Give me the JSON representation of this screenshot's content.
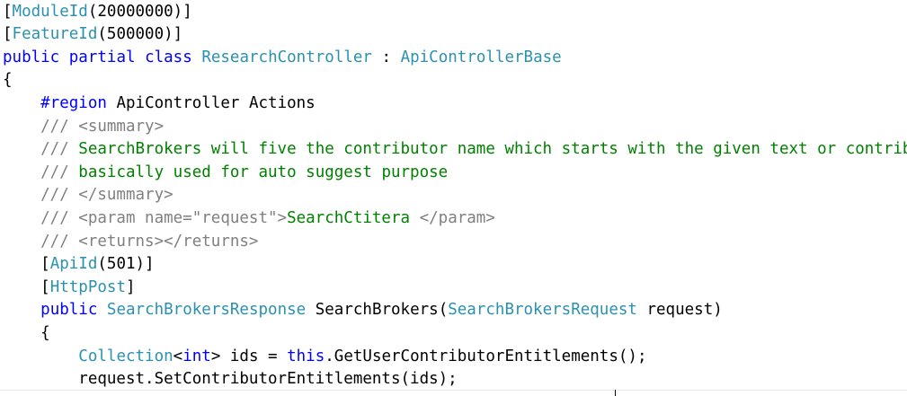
{
  "editor": {
    "language": "C#",
    "colors": {
      "background": "#ffffff",
      "plain": "#000000",
      "keyword": "#0000ff",
      "type": "#2b91af",
      "comment": "#008000",
      "xmldoc": "#808080",
      "directive": "#0000ff"
    },
    "lines": [
      {
        "tokens": [
          {
            "text": "[",
            "kind": "plain"
          },
          {
            "text": "ModuleId",
            "kind": "type"
          },
          {
            "text": "(20000000)]",
            "kind": "plain"
          }
        ]
      },
      {
        "tokens": [
          {
            "text": "[",
            "kind": "plain"
          },
          {
            "text": "FeatureId",
            "kind": "type"
          },
          {
            "text": "(500000)]",
            "kind": "plain"
          }
        ]
      },
      {
        "tokens": [
          {
            "text": "public",
            "kind": "keyword"
          },
          {
            "text": " ",
            "kind": "plain"
          },
          {
            "text": "partial",
            "kind": "keyword"
          },
          {
            "text": " ",
            "kind": "plain"
          },
          {
            "text": "class",
            "kind": "keyword"
          },
          {
            "text": " ",
            "kind": "plain"
          },
          {
            "text": "ResearchController",
            "kind": "type"
          },
          {
            "text": " : ",
            "kind": "plain"
          },
          {
            "text": "ApiControllerBase",
            "kind": "type"
          }
        ]
      },
      {
        "tokens": [
          {
            "text": "{",
            "kind": "plain"
          }
        ]
      },
      {
        "tokens": [
          {
            "text": "    ",
            "kind": "plain"
          },
          {
            "text": "#region",
            "kind": "directive"
          },
          {
            "text": " ApiController Actions",
            "kind": "plain"
          }
        ]
      },
      {
        "tokens": [
          {
            "text": "    /// <summary>",
            "kind": "xmldoc"
          }
        ]
      },
      {
        "tokens": [
          {
            "text": "    /// ",
            "kind": "xmldoc"
          },
          {
            "text": "SearchBrokers will five the contributor name which starts with the given text or contributor type",
            "kind": "comment"
          }
        ]
      },
      {
        "tokens": [
          {
            "text": "    /// ",
            "kind": "xmldoc"
          },
          {
            "text": "basically used for auto suggest purpose",
            "kind": "comment"
          }
        ]
      },
      {
        "tokens": [
          {
            "text": "    /// </summary>",
            "kind": "xmldoc"
          }
        ]
      },
      {
        "tokens": [
          {
            "text": "    /// <param name=\"request\">",
            "kind": "xmldoc"
          },
          {
            "text": "SearchCtitera ",
            "kind": "comment"
          },
          {
            "text": "</param>",
            "kind": "xmldoc"
          }
        ]
      },
      {
        "tokens": [
          {
            "text": "    /// <returns></returns>",
            "kind": "xmldoc"
          }
        ]
      },
      {
        "tokens": [
          {
            "text": "    [",
            "kind": "plain"
          },
          {
            "text": "ApiId",
            "kind": "type"
          },
          {
            "text": "(501)]",
            "kind": "plain"
          }
        ]
      },
      {
        "tokens": [
          {
            "text": "    [",
            "kind": "plain"
          },
          {
            "text": "HttpPost",
            "kind": "type"
          },
          {
            "text": "]",
            "kind": "plain"
          }
        ]
      },
      {
        "tokens": [
          {
            "text": "    ",
            "kind": "plain"
          },
          {
            "text": "public",
            "kind": "keyword"
          },
          {
            "text": " ",
            "kind": "plain"
          },
          {
            "text": "SearchBrokersResponse",
            "kind": "type"
          },
          {
            "text": " SearchBrokers(",
            "kind": "plain"
          },
          {
            "text": "SearchBrokersRequest",
            "kind": "type"
          },
          {
            "text": " request)",
            "kind": "plain"
          }
        ]
      },
      {
        "tokens": [
          {
            "text": "    {",
            "kind": "plain"
          }
        ]
      },
      {
        "tokens": [
          {
            "text": "        ",
            "kind": "plain"
          },
          {
            "text": "Collection",
            "kind": "type"
          },
          {
            "text": "<",
            "kind": "plain"
          },
          {
            "text": "int",
            "kind": "keyword"
          },
          {
            "text": "> ids = ",
            "kind": "plain"
          },
          {
            "text": "this",
            "kind": "keyword"
          },
          {
            "text": ".GetUserContributorEntitlements();",
            "kind": "plain"
          }
        ]
      },
      {
        "tokens": [
          {
            "text": "        request.SetContributorEntitlements(ids);",
            "kind": "plain"
          }
        ]
      }
    ]
  }
}
